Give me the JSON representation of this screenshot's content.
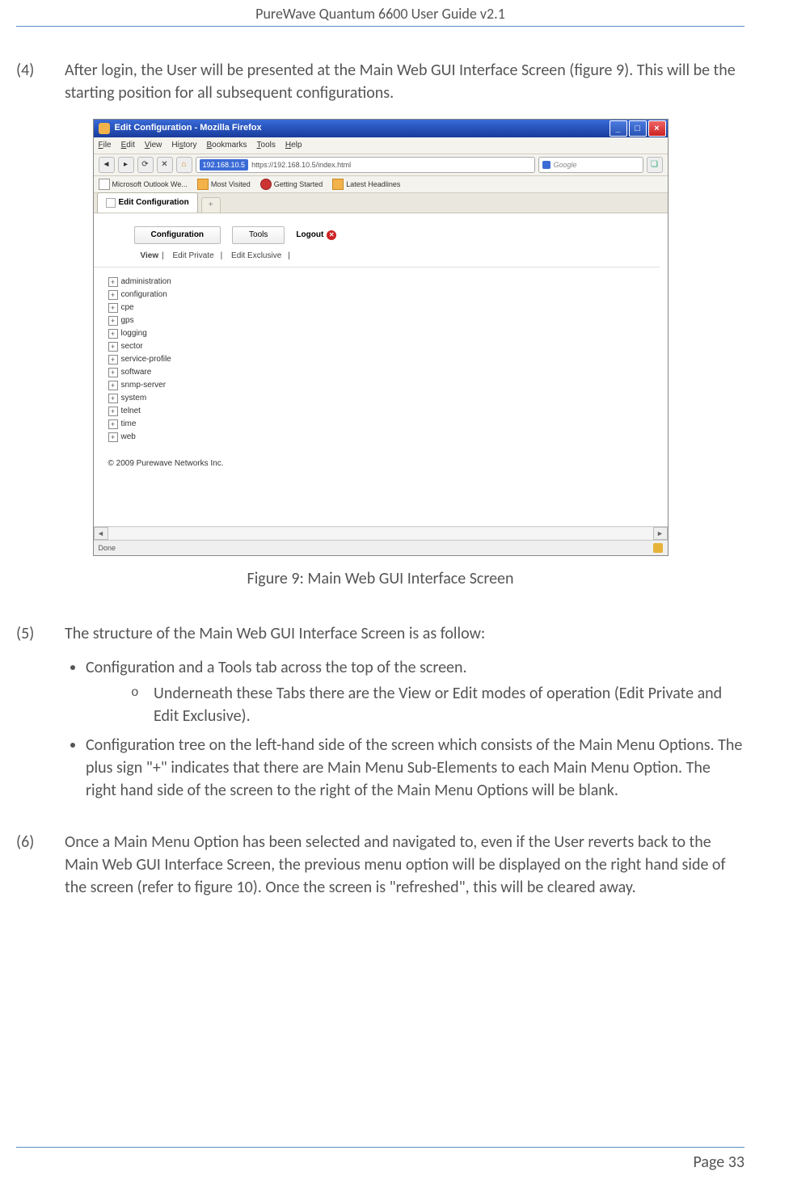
{
  "header": {
    "title": "PureWave Quantum 6600 User Guide v2.1"
  },
  "steps": {
    "s4": {
      "num": "(4)",
      "text": "After login, the User will be presented at the Main Web GUI Interface Screen (figure 9). This will be the starting position for all subsequent configurations."
    },
    "s5": {
      "num": "(5)",
      "intro": "The structure of the Main Web GUI Interface Screen is as follow:"
    },
    "s6": {
      "num": "(6)",
      "text": "Once a Main Menu Option has been selected and navigated to, even if the User reverts back to the Main Web GUI Interface Screen, the previous menu option will be displayed on the right hand side of the screen (refer to figure 10). Once the screen is \"refreshed\", this will be cleared away."
    }
  },
  "bullets": {
    "b1": "Configuration and a Tools tab across the top of the screen.",
    "b1a": "Underneath these Tabs there are the View or Edit modes of operation (Edit Private and Edit Exclusive).",
    "b2": "Configuration tree on the left-hand side of the screen which consists of the Main Menu Options. The plus sign \"+\" indicates that there are Main Menu Sub-Elements to each Main Menu Option. The right hand side of the screen to the right of the Main Menu Options will be blank."
  },
  "caption": "Figure 9: Main Web GUI Interface Screen",
  "browser": {
    "title": "Edit Configuration - Mozilla Firefox",
    "menu": {
      "file": "File",
      "edit": "Edit",
      "view": "View",
      "history": "History",
      "bookmarks": "Bookmarks",
      "tools": "Tools",
      "help": "Help"
    },
    "url_ip": "192.168.10.5",
    "url_rest": " https://192.168.10.5/index.html",
    "search_placeholder": "Google",
    "bookmarks": {
      "a": "Microsoft Outlook We...",
      "b": "Most Visited",
      "c": "Getting Started",
      "d": "Latest Headlines"
    },
    "tab": "Edit Configuration",
    "gtabs": {
      "config": "Configuration",
      "tools": "Tools",
      "logout": "Logout"
    },
    "sublinks": {
      "view": "View",
      "editp": "Edit Private",
      "edite": "Edit Exclusive"
    },
    "tree": [
      "administration",
      "configuration",
      "cpe",
      "gps",
      "logging",
      "sector",
      "service-profile",
      "software",
      "snmp-server",
      "system",
      "telnet",
      "time",
      "web"
    ],
    "copyright": "© 2009 Purewave Networks Inc.",
    "status": "Done"
  },
  "footer": {
    "page": "Page 33"
  }
}
